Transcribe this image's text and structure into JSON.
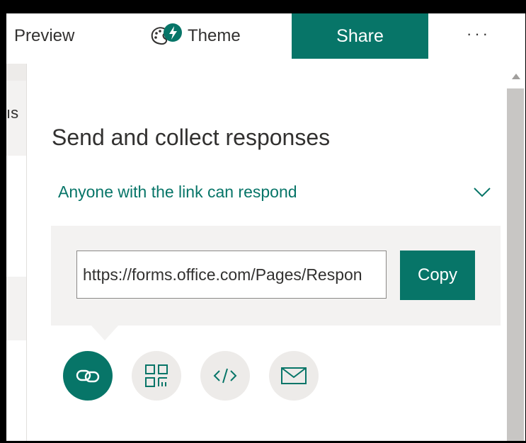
{
  "topbar": {
    "preview_label": "Preview",
    "theme_label": "Theme",
    "share_label": "Share",
    "more_label": "···"
  },
  "left_strip": {
    "partial_text": "ıs"
  },
  "share_panel": {
    "title": "Send and collect responses",
    "permission": "Anyone with the link can respond",
    "link_url": "https://forms.office.com/Pages/Respon",
    "copy_label": "Copy",
    "options": [
      {
        "icon": "link-icon",
        "selected": true
      },
      {
        "icon": "qr-code-icon",
        "selected": false
      },
      {
        "icon": "embed-code-icon",
        "selected": false
      },
      {
        "icon": "email-icon",
        "selected": false
      }
    ]
  },
  "colors": {
    "accent": "#077568",
    "panel_bg": "#f3f2f1",
    "option_bg": "#edebe9",
    "text": "#323130"
  }
}
